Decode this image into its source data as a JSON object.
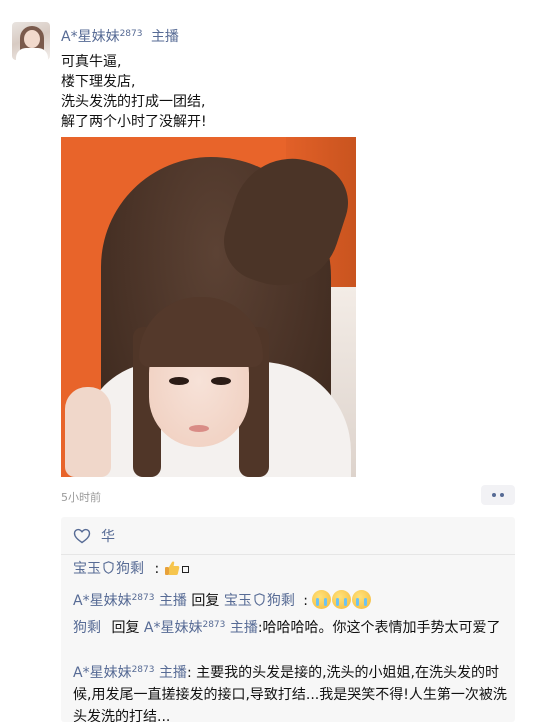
{
  "post": {
    "author": {
      "name": "A*星妹妹",
      "badge_num": "2873",
      "role": "主播"
    },
    "lines": [
      "可真牛逼,",
      "楼下理发店,",
      "洗头发洗的打成一团结,",
      "解了两个小时了没解开!"
    ],
    "time": "5小时前"
  },
  "likes": {
    "names": "华"
  },
  "comments": [
    {
      "user": "宝玉",
      "user2": "狗剩",
      "sep": ":"
    },
    {
      "user": "A*星妹妹",
      "user_num": "2873",
      "user_role": "主播",
      "reply_word": "回复",
      "target": "宝玉",
      "target2": "狗剩",
      "sep": ":"
    },
    {
      "user": "狗剩",
      "reply_word": "回复",
      "target": "A*星妹妹",
      "target_num": "2873",
      "target_role": "主播",
      "text": ":哈哈哈哈。你这个表情加手势太可爱了"
    },
    {
      "user": "A*星妹妹",
      "user_num": "2873",
      "user_role": "主播",
      "text": ": 主要我的头发是接的,洗头的小姐姐,在洗头发的时候,用发尾一直搓接发的接口,导致打结...我是哭笑不得!人生第一次被洗头发洗的打结..."
    }
  ],
  "colors": {
    "link": "#576b95",
    "panel": "#f7f7f7",
    "time": "#9a9a9a"
  },
  "icons": [
    "heart-outline-icon",
    "shield-icon",
    "thumbs-up-emoji",
    "crying-emoji",
    "more-dots-icon"
  ]
}
